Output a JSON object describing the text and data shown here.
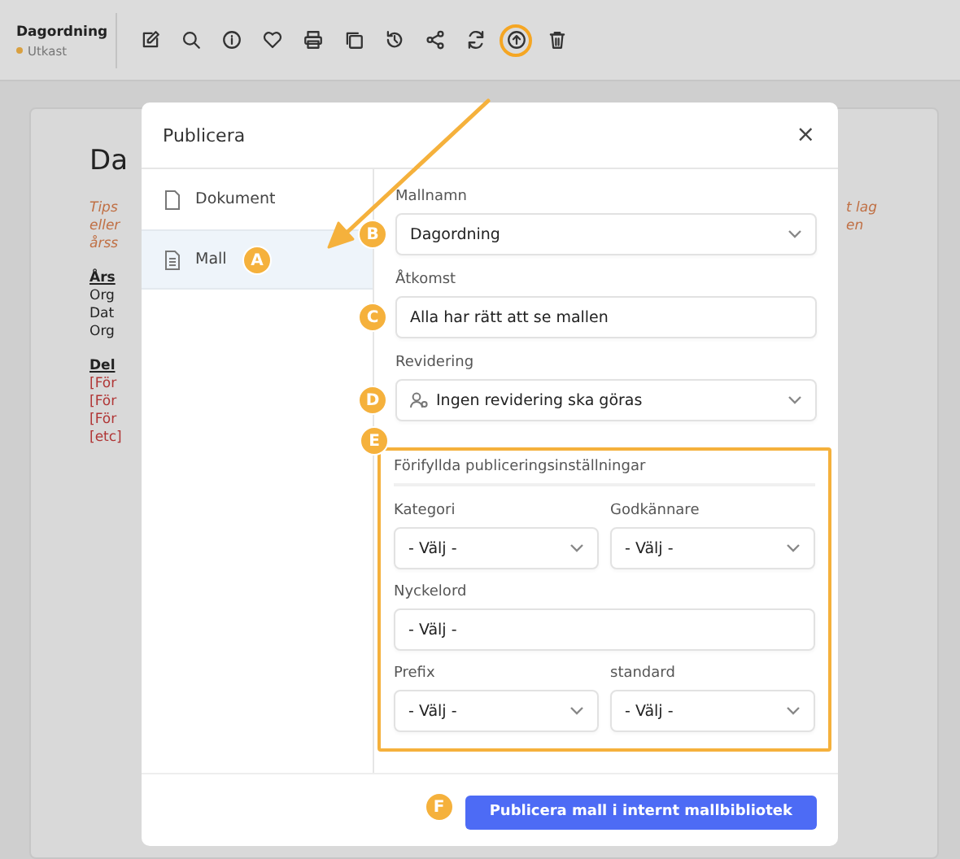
{
  "header": {
    "title": "Dagordning",
    "status": "Utkast"
  },
  "toolbar": [
    {
      "kind": "edit",
      "highlighted": false
    },
    {
      "kind": "search",
      "highlighted": false
    },
    {
      "kind": "info",
      "highlighted": false
    },
    {
      "kind": "heart",
      "highlighted": false
    },
    {
      "kind": "print",
      "highlighted": false
    },
    {
      "kind": "copy",
      "highlighted": false
    },
    {
      "kind": "history",
      "highlighted": false
    },
    {
      "kind": "share",
      "highlighted": false
    },
    {
      "kind": "sync",
      "highlighted": false
    },
    {
      "kind": "upload",
      "highlighted": true
    },
    {
      "kind": "trash",
      "highlighted": false
    }
  ],
  "document": {
    "heading": "Da",
    "left_lines": [
      {
        "kind": "tip",
        "text": "Tips"
      },
      {
        "kind": "tip",
        "text": "eller"
      },
      {
        "kind": "tip",
        "text": "årss"
      },
      {
        "kind": "gap"
      },
      {
        "kind": "heading",
        "text": "Års"
      },
      {
        "kind": "plain",
        "text": "Org"
      },
      {
        "kind": "plain",
        "text": "Dat"
      },
      {
        "kind": "plain",
        "text": "Org"
      },
      {
        "kind": "gap"
      },
      {
        "kind": "heading",
        "text": "Del"
      },
      {
        "kind": "placeholder",
        "text": "[För"
      },
      {
        "kind": "placeholder",
        "text": "[För"
      },
      {
        "kind": "placeholder",
        "text": "[För"
      },
      {
        "kind": "placeholder",
        "text": "[etc]"
      }
    ],
    "right_lines": [
      "t lag",
      "en"
    ]
  },
  "dialog": {
    "title": "Publicera",
    "close": "×",
    "nav": [
      {
        "label": "Dokument",
        "selected": false
      },
      {
        "label": "Mall",
        "selected": true,
        "marker": "A"
      }
    ],
    "fields": [
      {
        "label": "Mallnamn",
        "value": "Dagordning",
        "kind": "select",
        "marker": "B"
      },
      {
        "label": "Åtkomst",
        "value": "Alla har rätt att se mallen",
        "kind": "text",
        "marker": "C"
      },
      {
        "label": "Revidering",
        "value": "Ingen revidering ska göras",
        "kind": "person-select",
        "marker": "D"
      }
    ],
    "prefilled": {
      "title": "Förifyllda publiceringsinställningar",
      "marker": "E",
      "fields": [
        {
          "label": "Kategori",
          "value": "- Välj -",
          "kind": "select"
        },
        {
          "label": "Godkännare",
          "value": "- Välj -",
          "kind": "select"
        },
        {
          "label": "Nyckelord",
          "value": "- Välj -",
          "kind": "text"
        },
        {
          "label": "Prefix",
          "value": "- Välj -",
          "kind": "select"
        },
        {
          "label": "standard",
          "value": "- Välj -",
          "kind": "select"
        }
      ]
    },
    "submit": {
      "label": "Publicera mall i internt mallbibliotek",
      "marker": "F"
    }
  }
}
